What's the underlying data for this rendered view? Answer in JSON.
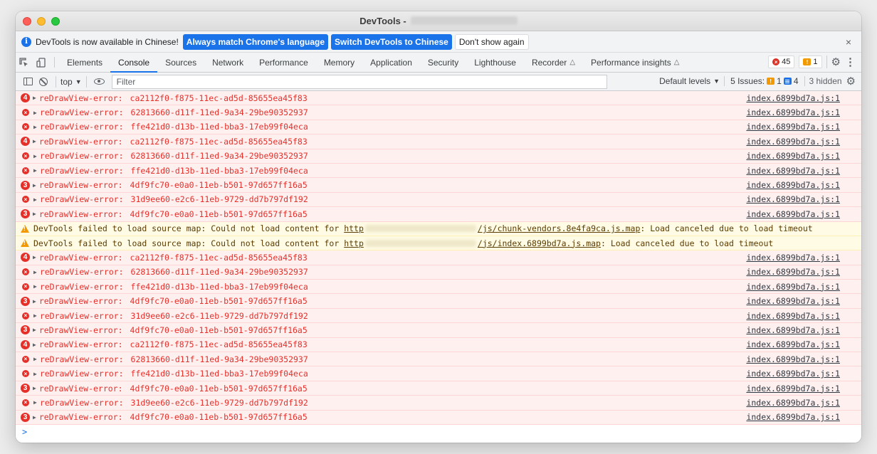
{
  "window": {
    "title": "DevTools -"
  },
  "infobar": {
    "text": "DevTools is now available in Chinese!",
    "match_button": "Always match Chrome's language",
    "switch_button": "Switch DevTools to Chinese",
    "dismiss_button": "Don't show again",
    "close": "×"
  },
  "tabs": [
    {
      "label": "Elements"
    },
    {
      "label": "Console",
      "active": true
    },
    {
      "label": "Sources"
    },
    {
      "label": "Network"
    },
    {
      "label": "Performance"
    },
    {
      "label": "Memory"
    },
    {
      "label": "Application"
    },
    {
      "label": "Security"
    },
    {
      "label": "Lighthouse"
    },
    {
      "label": "Recorder"
    },
    {
      "label": "Performance insights"
    }
  ],
  "tab_counts": {
    "errors": "45",
    "warnings": "1"
  },
  "toolbar": {
    "context": "top",
    "filter_placeholder": "Filter",
    "levels": "Default levels",
    "issues_label": "5 Issues:",
    "issues_warn": "1",
    "issues_info": "4",
    "hidden": "3 hidden"
  },
  "colors": {
    "error": "#e5302a",
    "warning_bg": "#fffbe5",
    "accent": "#1a73e8"
  },
  "messages": [
    {
      "type": "error",
      "count": "4",
      "name": "reDrawView-error:",
      "id": "ca2112f0-f875-11ec-ad5d-85655ea45f83",
      "source": "index.6899bd7a.js:1"
    },
    {
      "type": "error",
      "count": "",
      "name": "reDrawView-error:",
      "id": "62813660-d11f-11ed-9a34-29be90352937",
      "source": "index.6899bd7a.js:1"
    },
    {
      "type": "error",
      "count": "",
      "name": "reDrawView-error:",
      "id": "ffe421d0-d13b-11ed-bba3-17eb99f04eca",
      "source": "index.6899bd7a.js:1"
    },
    {
      "type": "error",
      "count": "4",
      "name": "reDrawView-error:",
      "id": "ca2112f0-f875-11ec-ad5d-85655ea45f83",
      "source": "index.6899bd7a.js:1"
    },
    {
      "type": "error",
      "count": "",
      "name": "reDrawView-error:",
      "id": "62813660-d11f-11ed-9a34-29be90352937",
      "source": "index.6899bd7a.js:1"
    },
    {
      "type": "error",
      "count": "",
      "name": "reDrawView-error:",
      "id": "ffe421d0-d13b-11ed-bba3-17eb99f04eca",
      "source": "index.6899bd7a.js:1"
    },
    {
      "type": "error",
      "count": "3",
      "name": "reDrawView-error:",
      "id": "4df9fc70-e0a0-11eb-b501-97d657ff16a5",
      "source": "index.6899bd7a.js:1"
    },
    {
      "type": "error",
      "count": "",
      "name": "reDrawView-error:",
      "id": "31d9ee60-e2c6-11eb-9729-dd7b797df192",
      "source": "index.6899bd7a.js:1"
    },
    {
      "type": "error",
      "count": "3",
      "name": "reDrawView-error:",
      "id": "4df9fc70-e0a0-11eb-b501-97d657ff16a5",
      "source": "index.6899bd7a.js:1"
    },
    {
      "type": "warning",
      "prefix": "DevTools failed to load source map: Could not load content for ",
      "url_start": "http",
      "url_end": "/js/chunk-vendors.8e4fa9ca.js.map",
      "suffix": ": Load canceled due to load timeout"
    },
    {
      "type": "warning",
      "prefix": "DevTools failed to load source map: Could not load content for ",
      "url_start": "http",
      "url_end": "/js/index.6899bd7a.js.map",
      "suffix": ": Load canceled due to load timeout"
    },
    {
      "type": "error",
      "count": "4",
      "name": "reDrawView-error:",
      "id": "ca2112f0-f875-11ec-ad5d-85655ea45f83",
      "source": "index.6899bd7a.js:1"
    },
    {
      "type": "error",
      "count": "",
      "name": "reDrawView-error:",
      "id": "62813660-d11f-11ed-9a34-29be90352937",
      "source": "index.6899bd7a.js:1"
    },
    {
      "type": "error",
      "count": "",
      "name": "reDrawView-error:",
      "id": "ffe421d0-d13b-11ed-bba3-17eb99f04eca",
      "source": "index.6899bd7a.js:1"
    },
    {
      "type": "error",
      "count": "3",
      "name": "reDrawView-error:",
      "id": "4df9fc70-e0a0-11eb-b501-97d657ff16a5",
      "source": "index.6899bd7a.js:1"
    },
    {
      "type": "error",
      "count": "",
      "name": "reDrawView-error:",
      "id": "31d9ee60-e2c6-11eb-9729-dd7b797df192",
      "source": "index.6899bd7a.js:1"
    },
    {
      "type": "error",
      "count": "3",
      "name": "reDrawView-error:",
      "id": "4df9fc70-e0a0-11eb-b501-97d657ff16a5",
      "source": "index.6899bd7a.js:1"
    },
    {
      "type": "error",
      "count": "4",
      "name": "reDrawView-error:",
      "id": "ca2112f0-f875-11ec-ad5d-85655ea45f83",
      "source": "index.6899bd7a.js:1"
    },
    {
      "type": "error",
      "count": "",
      "name": "reDrawView-error:",
      "id": "62813660-d11f-11ed-9a34-29be90352937",
      "source": "index.6899bd7a.js:1"
    },
    {
      "type": "error",
      "count": "",
      "name": "reDrawView-error:",
      "id": "ffe421d0-d13b-11ed-bba3-17eb99f04eca",
      "source": "index.6899bd7a.js:1"
    },
    {
      "type": "error",
      "count": "3",
      "name": "reDrawView-error:",
      "id": "4df9fc70-e0a0-11eb-b501-97d657ff16a5",
      "source": "index.6899bd7a.js:1"
    },
    {
      "type": "error",
      "count": "",
      "name": "reDrawView-error:",
      "id": "31d9ee60-e2c6-11eb-9729-dd7b797df192",
      "source": "index.6899bd7a.js:1"
    },
    {
      "type": "error",
      "count": "3",
      "name": "reDrawView-error:",
      "id": "4df9fc70-e0a0-11eb-b501-97d657ff16a5",
      "source": "index.6899bd7a.js:1"
    }
  ],
  "prompt": ">"
}
